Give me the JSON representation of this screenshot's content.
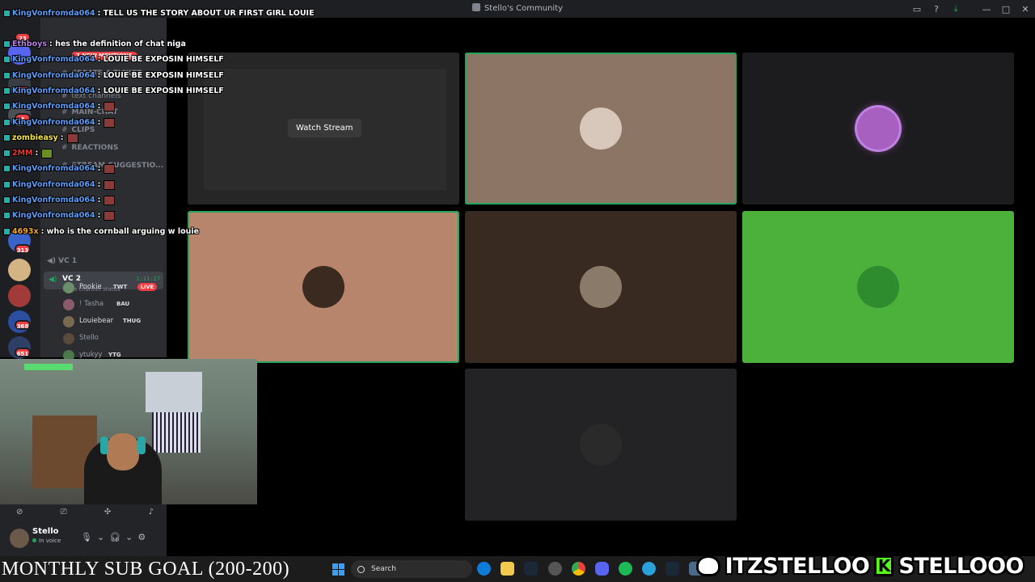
{
  "window": {
    "title": "Stello's Community"
  },
  "chat": [
    {
      "user": "KingVonfromda064",
      "text": ": TELL US THE STORY ABOUT UR FIRST GIRL LOUIE",
      "user_color": "#5b9bf8"
    },
    {
      "user": "Ethboys",
      "text": ": hes the definition of chat niga",
      "user_color": "#b57edc"
    },
    {
      "user": "KingVonfromda064",
      "text": ": LOUIE BE EXPOSIN HIMSELF",
      "user_color": "#5b9bf8"
    },
    {
      "user": "KingVonfromda064",
      "text": ": LOUIE BE EXPOSIN HIMSELF",
      "user_color": "#5b9bf8"
    },
    {
      "user": "KingVonfromda064",
      "text": ": LOUIE BE EXPOSIN HIMSELF",
      "user_color": "#5b9bf8"
    },
    {
      "user": "KingVonfromda064",
      "text": ":",
      "user_color": "#5b9bf8"
    },
    {
      "user": "KingVonfromda064",
      "text": ":",
      "user_color": "#5b9bf8"
    },
    {
      "user": "zombieasy",
      "text": ":",
      "user_color": "#f0e442"
    },
    {
      "user": "2MM",
      "text": ":",
      "user_color": "#e53935"
    },
    {
      "user": "KingVonfromda064",
      "text": ":",
      "user_color": "#5b9bf8"
    },
    {
      "user": "KingVonfromda064",
      "text": ":",
      "user_color": "#5b9bf8"
    },
    {
      "user": "KingVonfromda064",
      "text": ":",
      "user_color": "#5b9bf8"
    },
    {
      "user": "KingVonfromda064",
      "text": ":",
      "user_color": "#5b9bf8"
    },
    {
      "user": "4693x",
      "text": ": who is the cornball arguing w louie",
      "user_color": "#f5a623"
    }
  ],
  "sidebar": {
    "new_mentions": "7 NEW MENTIONS",
    "channels": [
      "create-a-ticket",
      "text channels",
      "main-chat",
      "clips",
      "reactions",
      "stream-suggestio..."
    ],
    "vc1": "VC 1",
    "vc2": {
      "name": "VC 2",
      "timer": "1:11:27",
      "status": "Set a channel status"
    },
    "members": [
      {
        "name": "Pookie",
        "tag": "TWT",
        "live": "LIVE",
        "color": "#6b8e6b"
      },
      {
        "name": "! Tasha",
        "tag": "BAU",
        "live": "",
        "color": "#8b5a6b"
      },
      {
        "name": "Louiebear",
        "tag": "THUG",
        "live": "",
        "color": "#7a6a50"
      },
      {
        "name": "Stello",
        "tag": "",
        "live": "",
        "color": "#5a4a3a"
      },
      {
        "name": "ytukyy",
        "tag": "YTG",
        "live": "",
        "color": "#4a7a4a"
      }
    ],
    "badges": [
      "23",
      "10",
      "3",
      "313",
      "368",
      "651"
    ]
  },
  "tiles": [
    {
      "bg": "#262626",
      "watch": "Watch Stream",
      "avatar": "",
      "speaking": false
    },
    {
      "bg": "#8c7565",
      "watch": "",
      "avatar": "#d8c8bc",
      "speaking": true
    },
    {
      "bg": "#1c1c1e",
      "watch": "",
      "avatar": "#a860c0",
      "speaking": false
    },
    {
      "bg": "#b7856b",
      "watch": "",
      "avatar": "#3a2a20",
      "speaking": true
    },
    {
      "bg": "#382a20",
      "watch": "",
      "avatar": "#8a7a6a",
      "speaking": false
    },
    {
      "bg": "#4cb13b",
      "watch": "",
      "avatar": "#2e8b2e",
      "speaking": false
    },
    {
      "bg": "#232326",
      "watch": "",
      "avatar": "#2a2a2a",
      "speaking": false
    }
  ],
  "user_panel": {
    "name": "Stello",
    "status": "In voice"
  },
  "overlay": {
    "sub_goal": "MONTHLY SUB GOAL (200-200)",
    "twitter": "ITZSTELLOO",
    "kick_logo": "K",
    "kick": "STELLOOO"
  },
  "taskbar": {
    "search_placeholder": "Search"
  }
}
